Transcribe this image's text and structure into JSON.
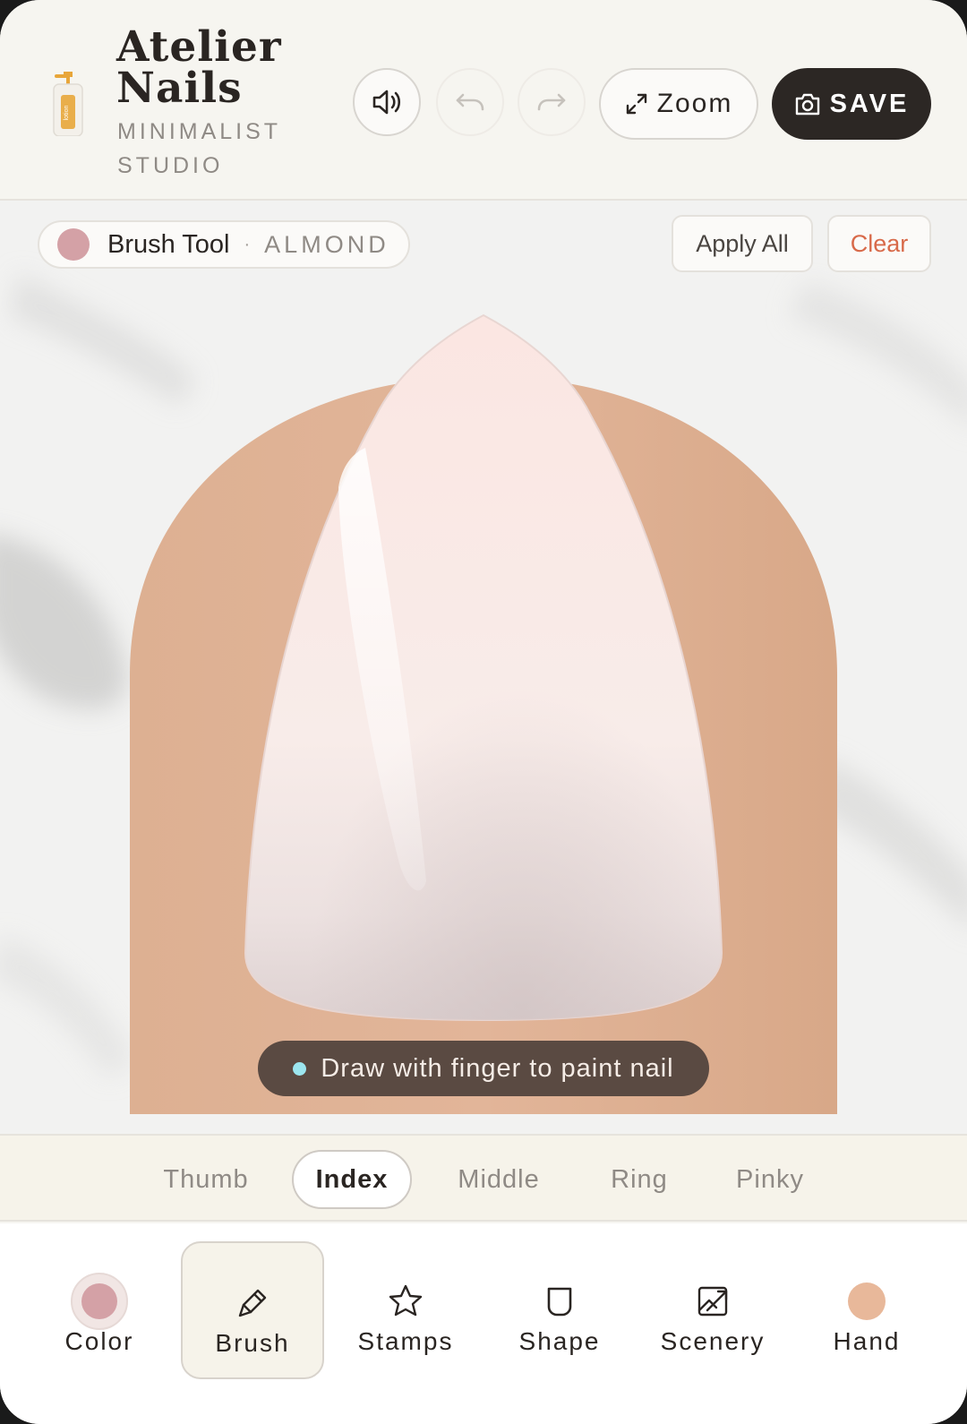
{
  "header": {
    "title": "Atelier Nails",
    "title_line1": "Atelier",
    "title_line2": "Nails",
    "subtitle": "MINIMALIST STUDIO",
    "logo_label": "lotion",
    "zoom_label": "Zoom",
    "save_label": "SAVE",
    "icons": {
      "sound": "speaker-icon",
      "undo": "undo-icon",
      "redo": "redo-icon",
      "zoom": "expand-icon",
      "save": "camera-icon"
    }
  },
  "canvas": {
    "tool_name": "Brush Tool",
    "tool_separator": "·",
    "nail_shape": "ALMOND",
    "apply_all_label": "Apply All",
    "clear_label": "Clear",
    "hint": "Draw with finger to paint nail"
  },
  "fingers": {
    "selected": "Index",
    "tabs": [
      {
        "label": "Thumb"
      },
      {
        "label": "Index"
      },
      {
        "label": "Middle"
      },
      {
        "label": "Ring"
      },
      {
        "label": "Pinky"
      }
    ]
  },
  "toolbar": {
    "selected": "Brush",
    "items": [
      {
        "label": "Color",
        "icon": "color-swatch-icon"
      },
      {
        "label": "Brush",
        "icon": "brush-icon"
      },
      {
        "label": "Stamps",
        "icon": "star-icon"
      },
      {
        "label": "Shape",
        "icon": "nail-shape-icon"
      },
      {
        "label": "Scenery",
        "icon": "image-icon"
      },
      {
        "label": "Hand",
        "icon": "skin-tone-icon"
      }
    ]
  },
  "colors": {
    "nail_color": "#d4a1a6",
    "skin_tone": "#e8b89a",
    "accent_dark": "#2c2724",
    "clear_text": "#d86a4a",
    "hint_dot": "#9ce6ef"
  }
}
